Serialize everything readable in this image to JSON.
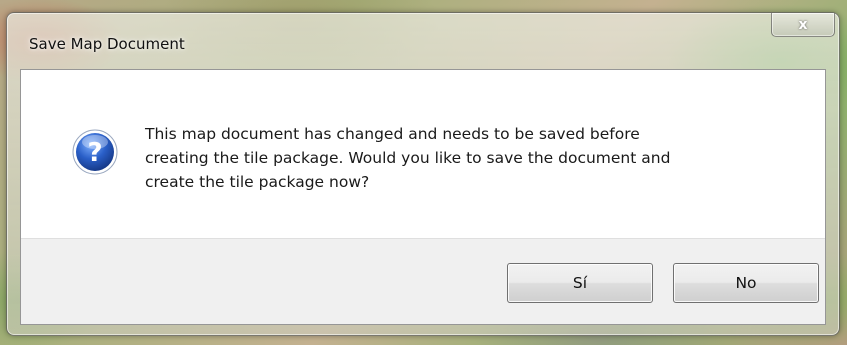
{
  "dialog": {
    "title": "Save Map Document",
    "close_symbol": "x",
    "icon": "question-icon",
    "message": "This map document has changed and needs to be saved before\ncreating the tile package.  Would you like to save the document and\ncreate the tile package now?",
    "buttons": {
      "yes_label": "Sí",
      "no_label": "No"
    }
  },
  "colors": {
    "icon_blue": "#2a5fc8",
    "footer_bg": "#f0f0f0"
  }
}
